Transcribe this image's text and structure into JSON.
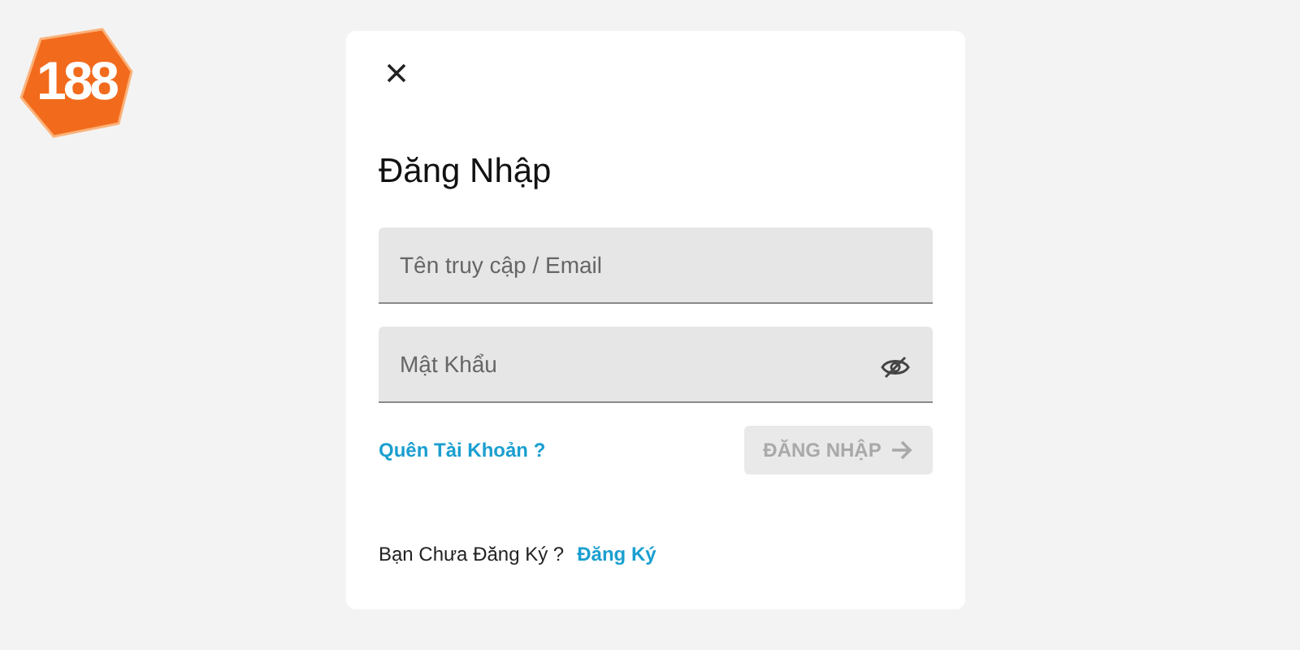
{
  "logo": {
    "text": "188"
  },
  "dialog": {
    "title": "Đăng Nhập",
    "fields": [
      {
        "placeholder": "Tên truy cập / Email",
        "kind": "text"
      },
      {
        "placeholder": "Mật Khẩu",
        "kind": "password"
      }
    ],
    "forgot_link": "Quên Tài Khoản ?",
    "submit": {
      "label": "ĐĂNG NHẬP",
      "disabled": true
    },
    "signup_prompt": "Bạn Chưa Đăng Ký ?",
    "signup_link": "Đăng Ký"
  }
}
